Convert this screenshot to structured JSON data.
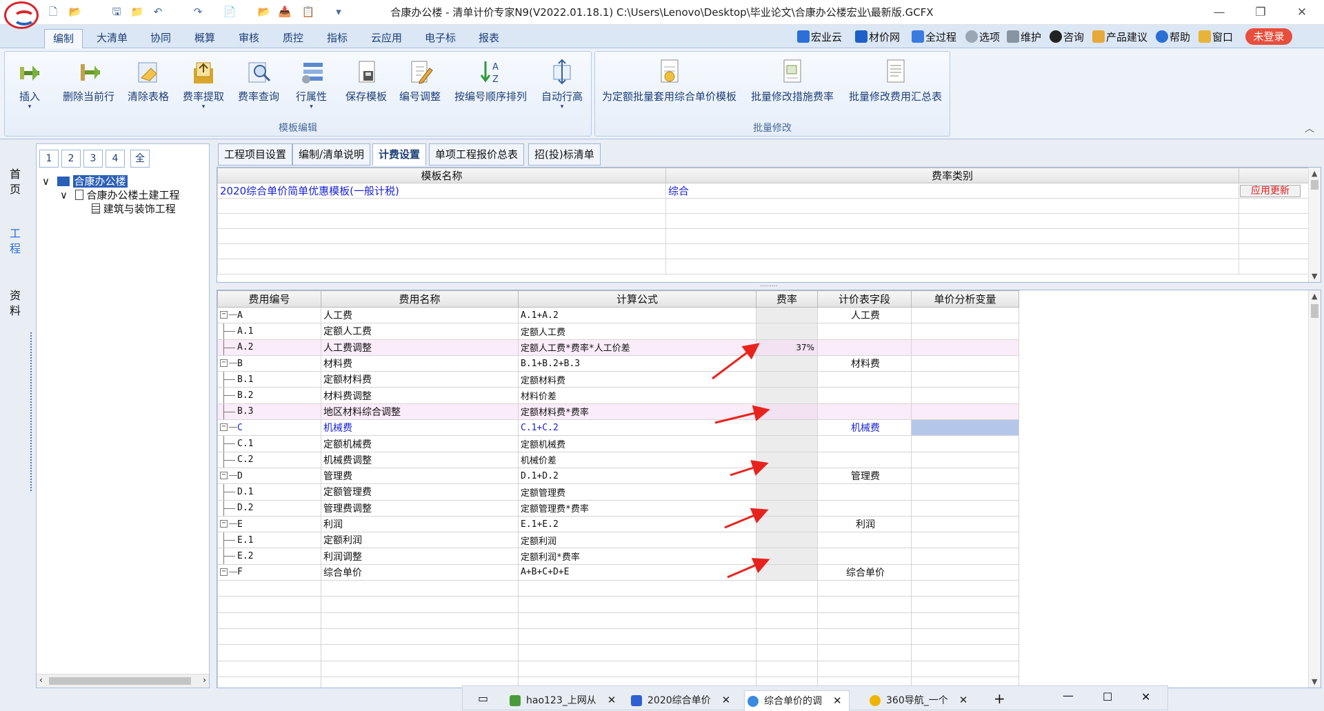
{
  "window": {
    "title": "合康办公楼 - 清单计价专家N9(V2022.01.18.1) C:\\Users\\Lenovo\\Desktop\\毕业论文\\合康办公楼宏业\\最新版.GCFX",
    "minimize": "—",
    "maximize": "❐",
    "close": "✕"
  },
  "menu": {
    "tabs": [
      "编制",
      "大清单",
      "协同",
      "概算",
      "审核",
      "质控",
      "指标",
      "云应用",
      "电子标",
      "报表"
    ],
    "right": [
      "宏业云",
      "材价网",
      "全过程",
      "选项",
      "维护",
      "咨询",
      "产品建议",
      "帮助",
      "窗口"
    ],
    "login": "未登录"
  },
  "ribbon": {
    "group1": {
      "label": "模板编辑",
      "buttons": [
        "插入",
        "删除当前行",
        "清除表格",
        "费率提取",
        "费率查询",
        "行属性",
        "保存模板",
        "编号调整",
        "按编号顺序排列",
        "自动行高"
      ]
    },
    "group2": {
      "label": "批量修改",
      "buttons": [
        "为定额批量套用综合单价模板",
        "批量修改措施费率",
        "批量修改费用汇总表"
      ]
    }
  },
  "sidebar": {
    "items": [
      "首页",
      "工程",
      "资料"
    ]
  },
  "tree": {
    "numtabs": [
      "1",
      "2",
      "3",
      "4",
      "全"
    ],
    "root": "合康办公楼",
    "child": "合康办公楼土建工程",
    "leaf": "建筑与装饰工程"
  },
  "panel_tabs": [
    "工程项目设置",
    "编制/清单说明",
    "计费设置",
    "单项工程报价总表",
    "招(投)标清单"
  ],
  "template_table": {
    "headers": [
      "模板名称",
      "费率类别",
      ""
    ],
    "row": {
      "name": "2020综合单价简单优惠模板(一般计税)",
      "category": "综合",
      "button": "应用更新"
    }
  },
  "fee_table": {
    "headers": [
      "费用编号",
      "费用名称",
      "计算公式",
      "费率",
      "计价表字段",
      "单价分析变量"
    ],
    "rows": [
      {
        "code": "A",
        "name": "人工费",
        "formula": "A.1+A.2",
        "rate": "",
        "field": "人工费",
        "parent": true
      },
      {
        "code": "A.1",
        "name": "定额人工费",
        "formula": "定额人工费",
        "rate": "",
        "field": ""
      },
      {
        "code": "A.2",
        "name": "人工费调整",
        "formula": "定额人工费*费率*人工价差",
        "rate": "37%",
        "field": "",
        "pink": true
      },
      {
        "code": "B",
        "name": "材料费",
        "formula": "B.1+B.2+B.3",
        "rate": "",
        "field": "材料费",
        "parent": true
      },
      {
        "code": "B.1",
        "name": "定额材料费",
        "formula": "定额材料费",
        "rate": "",
        "field": ""
      },
      {
        "code": "B.2",
        "name": "材料费调整",
        "formula": "材料价差",
        "rate": "",
        "field": ""
      },
      {
        "code": "B.3",
        "name": "地区材料综合调整",
        "formula": "定额材料费*费率",
        "rate": "",
        "field": "",
        "pink": true
      },
      {
        "code": "C",
        "name": "机械费",
        "formula": "C.1+C.2",
        "rate": "",
        "field": "机械费",
        "parent": true,
        "selected": true
      },
      {
        "code": "C.1",
        "name": "定额机械费",
        "formula": "定额机械费",
        "rate": "",
        "field": ""
      },
      {
        "code": "C.2",
        "name": "机械费调整",
        "formula": "机械价差",
        "rate": "",
        "field": ""
      },
      {
        "code": "D",
        "name": "管理费",
        "formula": "D.1+D.2",
        "rate": "",
        "field": "管理费",
        "parent": true
      },
      {
        "code": "D.1",
        "name": "定额管理费",
        "formula": "定额管理费",
        "rate": "",
        "field": ""
      },
      {
        "code": "D.2",
        "name": "管理费调整",
        "formula": "定额管理费*费率",
        "rate": "",
        "field": ""
      },
      {
        "code": "E",
        "name": "利润",
        "formula": "E.1+E.2",
        "rate": "",
        "field": "利润",
        "parent": true
      },
      {
        "code": "E.1",
        "name": "定额利润",
        "formula": "定额利润",
        "rate": "",
        "field": ""
      },
      {
        "code": "E.2",
        "name": "利润调整",
        "formula": "定额利润*费率",
        "rate": "",
        "field": ""
      },
      {
        "code": "F",
        "name": "综合单价",
        "formula": "A+B+C+D+E",
        "rate": "",
        "field": "综合单价",
        "parent": true
      }
    ]
  },
  "taskbar": {
    "tabs": [
      "hao123_上网从",
      "2020综合单价",
      "综合单价的调",
      "360导航_一个"
    ],
    "plus": "+"
  },
  "colors": {
    "accent": "#1d3f78",
    "arrow": "#e8231e",
    "login": "#e84e3c",
    "pink_row": "#fbecfa",
    "selected_cell": "#b4c7ea"
  }
}
